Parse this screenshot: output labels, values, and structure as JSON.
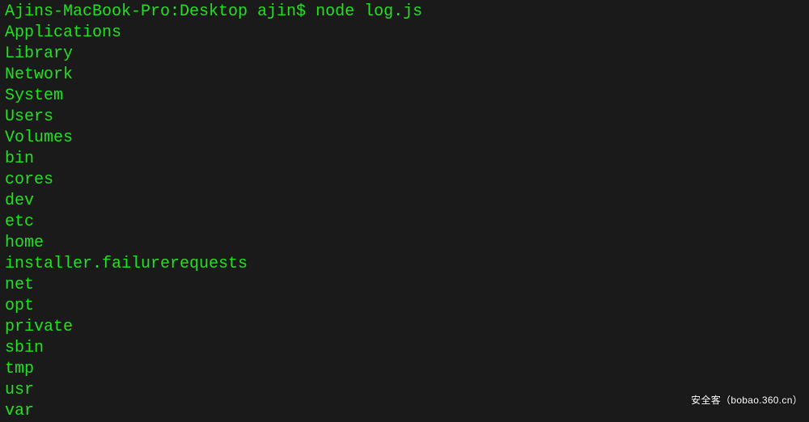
{
  "terminal": {
    "prompt": "Ajins-MacBook-Pro:Desktop ajin$ node log.js",
    "lines": [
      "Applications",
      "Library",
      "Network",
      "System",
      "Users",
      "Volumes",
      "bin",
      "cores",
      "dev",
      "etc",
      "home",
      "installer.failurerequests",
      "net",
      "opt",
      "private",
      "sbin",
      "tmp",
      "usr",
      "var"
    ]
  },
  "watermark": "安全客（bobao.360.cn）"
}
